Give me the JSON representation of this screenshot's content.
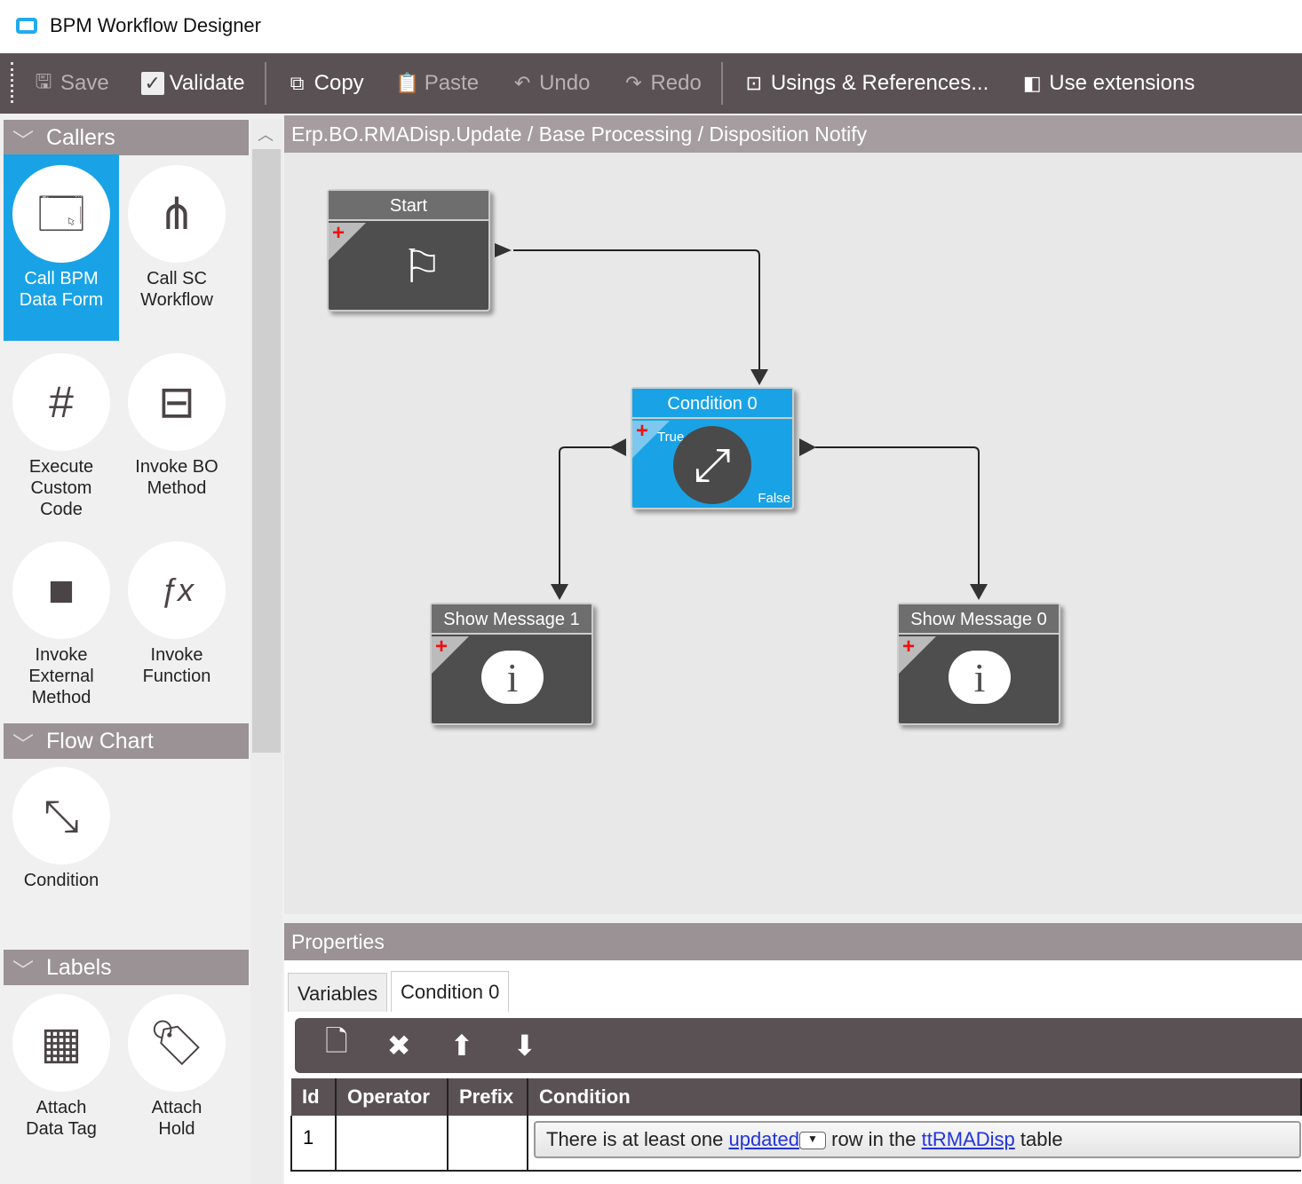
{
  "window": {
    "title": "BPM Workflow Designer"
  },
  "toolbar": {
    "save": "Save",
    "validate": "Validate",
    "copy": "Copy",
    "paste": "Paste",
    "undo": "Undo",
    "redo": "Redo",
    "usings": "Usings & References...",
    "extensions": "Use extensions"
  },
  "palette": {
    "callers": {
      "title": "Callers",
      "items": [
        "Call BPM Data Form",
        "Call SC Workflow",
        "Execute Custom Code",
        "Invoke BO Method",
        "Invoke External Method",
        "Invoke Function"
      ]
    },
    "flowchart": {
      "title": "Flow Chart",
      "items": [
        "Condition"
      ]
    },
    "labels": {
      "title": "Labels",
      "items": [
        "Attach Data Tag",
        "Attach Hold"
      ]
    }
  },
  "breadcrumb": "Erp.BO.RMADisp.Update / Base Processing / Disposition Notify",
  "nodes": {
    "start": "Start",
    "condition": "Condition 0",
    "true_label": "True",
    "false_label": "False",
    "msg1": "Show Message 1",
    "msg0": "Show Message 0"
  },
  "properties": {
    "title": "Properties",
    "tabs": [
      "Variables",
      "Condition 0"
    ],
    "columns": [
      "Id",
      "Operator",
      "Prefix",
      "Condition"
    ],
    "rows": [
      {
        "id": "1",
        "operator": "",
        "prefix": "",
        "cond_pre": "There is at least one",
        "cond_link1": "updated",
        "cond_mid": "row in the",
        "cond_link2": "ttRMADisp",
        "cond_post": "table"
      }
    ]
  },
  "colors": {
    "accent": "#19a3e6",
    "toolbar": "#5a5155"
  }
}
